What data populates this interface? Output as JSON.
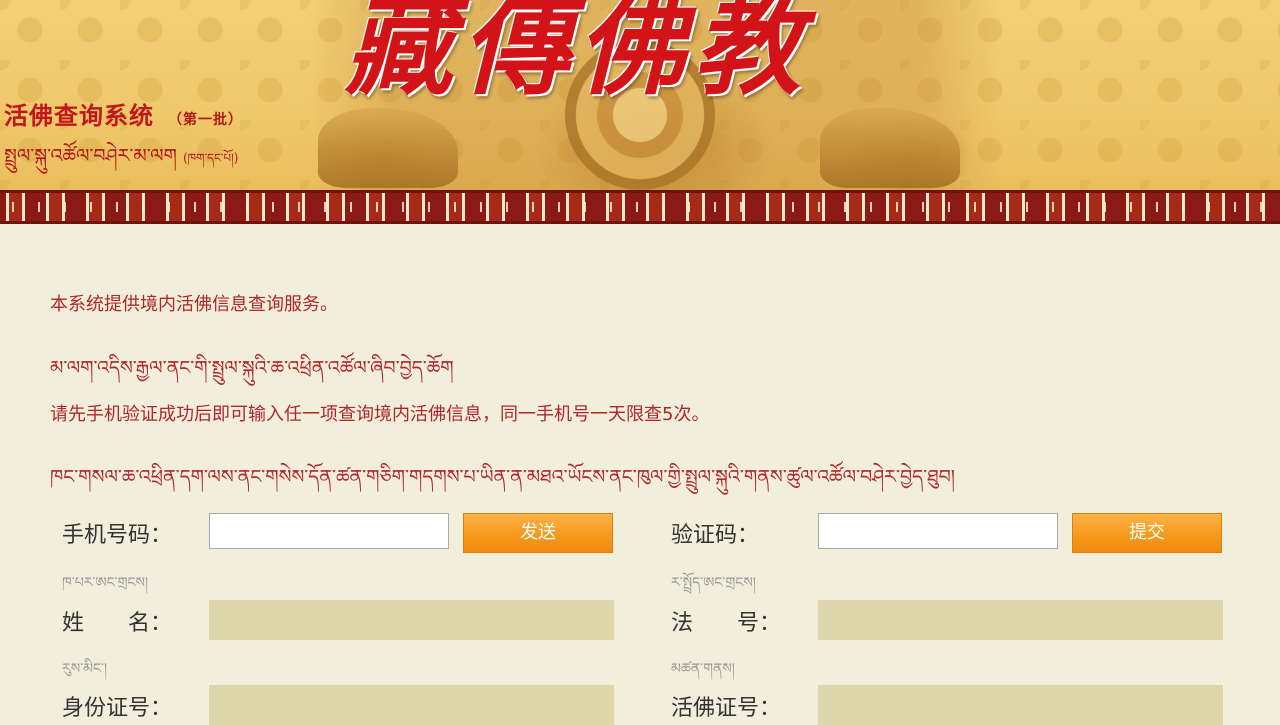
{
  "header": {
    "calligraphy": "藏傳佛教",
    "system_title": "活佛查询系统",
    "batch": "（第一批）",
    "system_title_tibetan": "སྤྲུལ་སྐུ་འཚོལ་བཤེར་མ་ལག",
    "batch_tibetan": "(ཁག་དང་པོ།)"
  },
  "intro": {
    "line1": "本系统提供境内活佛信息查询服务。",
    "line2": "མ་ལག་འདིས་རྒྱལ་ནང་གི་སྤྲུལ་སྐུའི་ཆ་འཕྲིན་འཚོལ་ཞིབ་བྱེད་ཆོག",
    "line3": "请先手机验证成功后即可输入任一项查询境内活佛信息，同一手机号一天限查5次。",
    "line4": "ཁང་གསལ་ཆ་འཕྲིན་དག་ལས་ནང་གསེས་དོན་ཚན་གཅིག་གདགས་པ་ཡིན་ན་མཐའ་ཡོངས་ནང་ཁུལ་གྱི་སྤྲུལ་སྐུའི་གནས་ཚུལ་འཚོལ་བཤེར་བྱེད་ཐུབ།"
  },
  "form": {
    "phone": {
      "label": "手机号码：",
      "sub": "ཁ་པར་ཨང་གྲངས།",
      "value": "",
      "placeholder": ""
    },
    "send_button": "发送",
    "code": {
      "label": "验证码：",
      "sub": "ར་སྤྲོད་ཨང་གྲངས།",
      "value": "",
      "placeholder": ""
    },
    "submit_button": "提交",
    "name": {
      "label": "姓　　名：",
      "sub": "རུས་མིང་།"
    },
    "dharma_name": {
      "label": "法　　号：",
      "sub": "མཚན་གནས།"
    },
    "id_number": {
      "label": "身份证号："
    },
    "living_buddha_id": {
      "label": "活佛证号："
    }
  }
}
